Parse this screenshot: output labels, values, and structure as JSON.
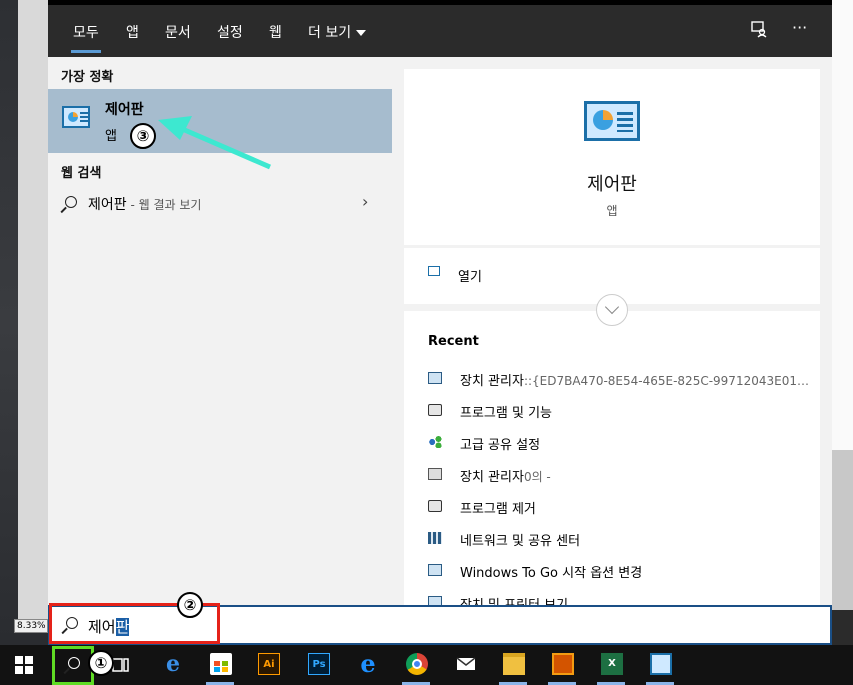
{
  "background": {
    "zoom_label": "8.33%"
  },
  "tabs": [
    {
      "label": "모두",
      "active": true
    },
    {
      "label": "앱"
    },
    {
      "label": "문서"
    },
    {
      "label": "설정"
    },
    {
      "label": "웹"
    },
    {
      "label": "더 보기"
    }
  ],
  "topbar": {
    "feedback_icon": "feedback-icon",
    "more_icon": "···"
  },
  "best_match": {
    "heading": "가장 정확",
    "title": "제어판",
    "subtitle": "앱",
    "icon": "control-panel-icon"
  },
  "web_search": {
    "heading": "웹 검색",
    "query": "제어판",
    "hint": " - 웹 결과 보기",
    "chevron": "›"
  },
  "detail": {
    "title": "제어판",
    "subtitle": "앱",
    "open_label": "열기",
    "recent_heading": "Recent",
    "recent": [
      {
        "label": "장치 관리자",
        "muted": "::{ED7BA470-8E54-465E-825C-99712043E01…",
        "icon": "monitor"
      },
      {
        "label": "프로그램 및 기능",
        "muted": "",
        "icon": "disc"
      },
      {
        "label": "고급 공유 설정",
        "muted": "",
        "icon": "share"
      },
      {
        "label": "장치 관리자",
        "muted": "0의 -",
        "icon": "tree"
      },
      {
        "label": "프로그램 제거",
        "muted": "",
        "icon": "disc"
      },
      {
        "label": "네트워크 및 공유 센터",
        "muted": "",
        "icon": "net"
      },
      {
        "label": "Windows To Go 시작 옵션 변경",
        "muted": "",
        "icon": "monitor"
      },
      {
        "label": "장치 및 프린터 보기",
        "muted": "",
        "icon": "monitor"
      }
    ]
  },
  "search": {
    "typed": "제어",
    "selected": "판"
  },
  "annotations": {
    "step1": "①",
    "step2": "②",
    "step3": "③"
  },
  "taskbar": {
    "apps": [
      {
        "name": "task-view",
        "label": ""
      },
      {
        "name": "edge",
        "label": "e"
      },
      {
        "name": "store",
        "label": ""
      },
      {
        "name": "illustrator",
        "label": "Ai"
      },
      {
        "name": "photoshop",
        "label": "Ps"
      },
      {
        "name": "internet-explorer",
        "label": "e"
      },
      {
        "name": "chrome",
        "label": ""
      },
      {
        "name": "mail",
        "label": ""
      },
      {
        "name": "file-explorer",
        "label": ""
      },
      {
        "name": "slideshow",
        "label": ""
      },
      {
        "name": "excel",
        "label": "X"
      },
      {
        "name": "control-panel",
        "label": ""
      }
    ]
  }
}
